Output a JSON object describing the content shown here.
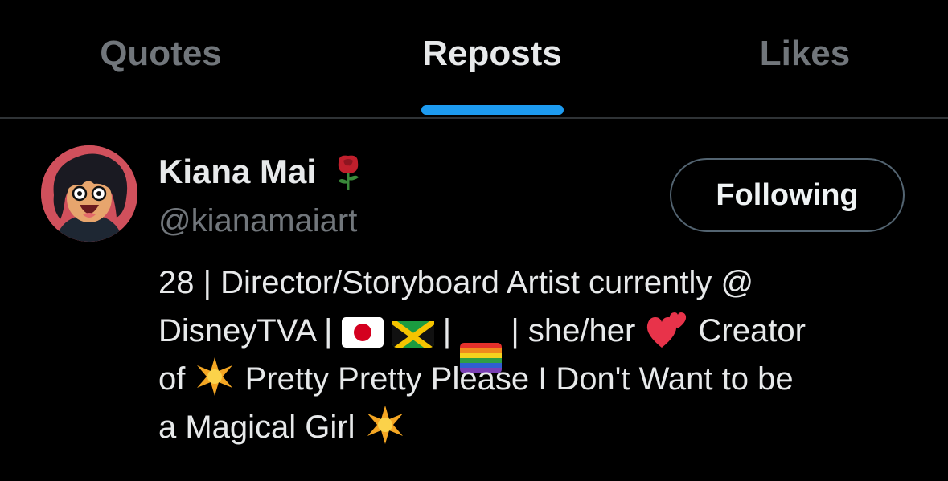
{
  "tabs": [
    {
      "label": "Quotes",
      "active": false
    },
    {
      "label": "Reposts",
      "active": true
    },
    {
      "label": "Likes",
      "active": false
    }
  ],
  "colors": {
    "background": "#000000",
    "accent": "#1d9bf0",
    "muted_text": "#71767b",
    "primary_text": "#e7e9ea",
    "divider": "#2f3336"
  },
  "user": {
    "display_name": "Kiana Mai",
    "display_name_emoji": "rose-icon",
    "handle": "@kianamaiart",
    "follow_button_label": "Following",
    "bio": {
      "line1": "28 | Director/Storyboard Artist currently @",
      "line2_a": "DisneyTVA | ",
      "line2_sep1": " | ",
      "line2_b": " | she/her ",
      "line2_c": " Creator",
      "line3_a": "of ",
      "line3_b": " Pretty Pretty Please I Don't Want to be",
      "line4": "a Magical Girl "
    },
    "bio_icons": [
      "japan-flag-icon",
      "jamaica-flag-icon",
      "rainbow-flag-icon",
      "two-hearts-icon",
      "sparkle-icon"
    ]
  }
}
